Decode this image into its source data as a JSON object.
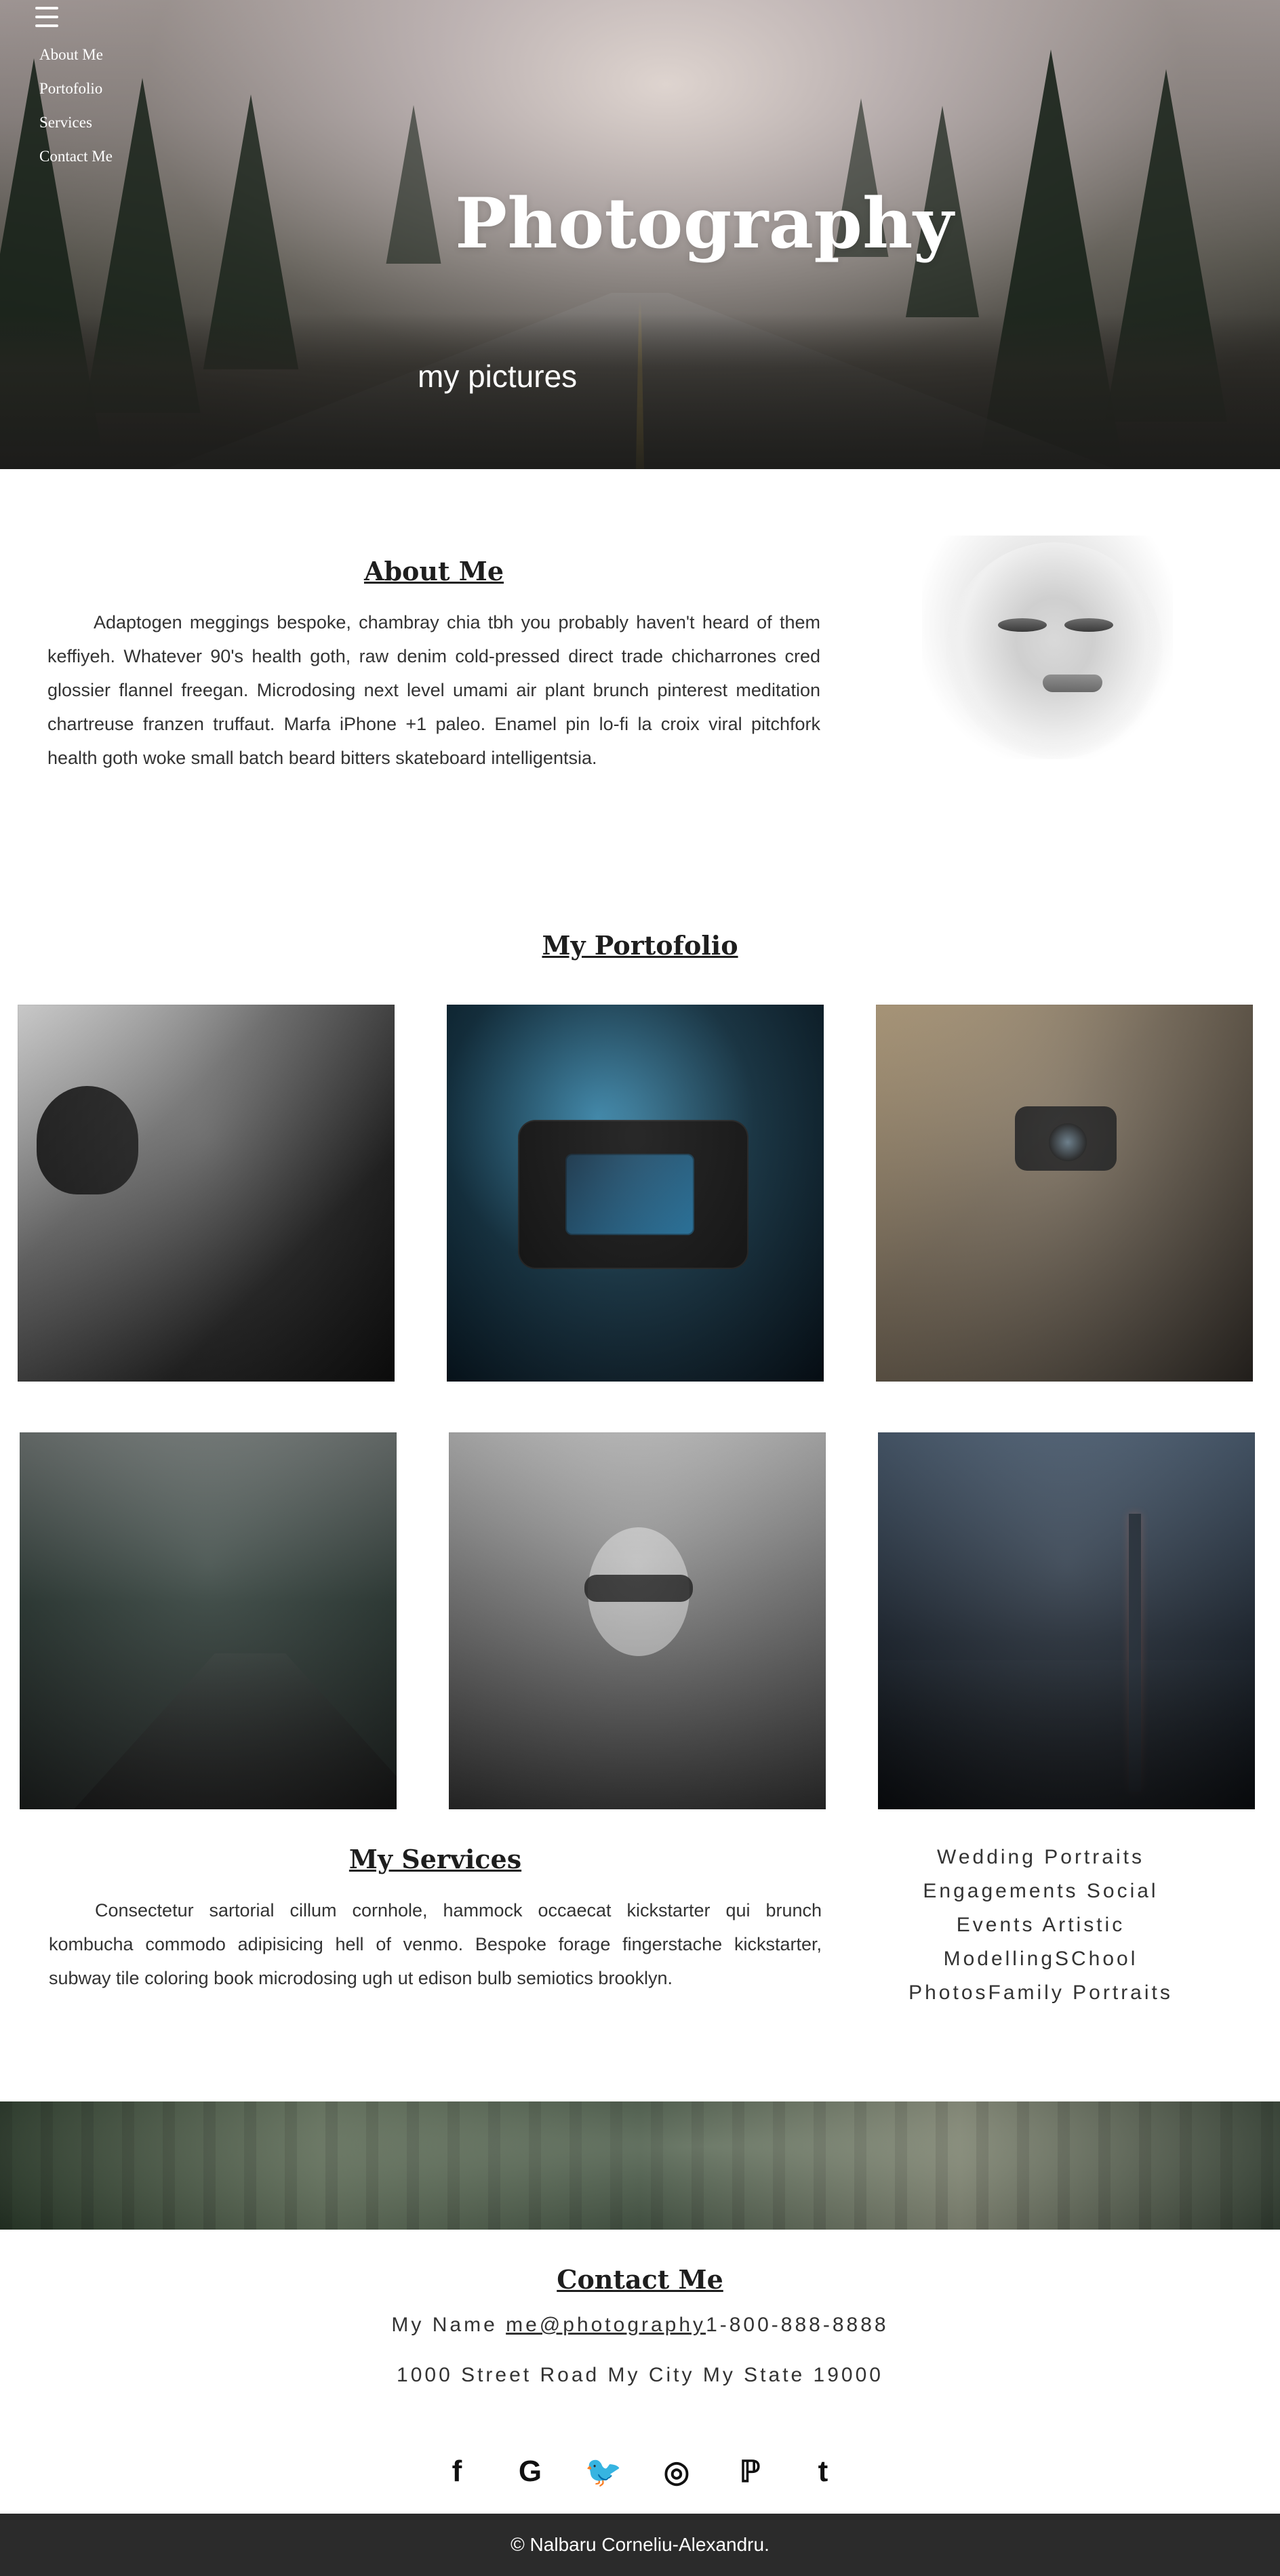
{
  "hero": {
    "title": "Photography",
    "subtitle": "my pictures"
  },
  "nav": {
    "menu_icon": "menu-icon",
    "items": [
      {
        "label": "About Me"
      },
      {
        "label": "Portofolio"
      },
      {
        "label": "Services"
      },
      {
        "label": "Contact Me"
      }
    ]
  },
  "about": {
    "title": "About Me",
    "text": "Adaptogen meggings bespoke, chambray chia tbh you probably haven't heard of them keffiyeh. Whatever 90's health goth, raw denim cold-pressed direct trade chicharrones cred glossier flannel freegan. Microdosing next level umami air plant brunch pinterest meditation chartreuse franzen truffaut. Marfa iPhone +1 paleo. Enamel pin lo-fi la croix viral pitchfork health goth woke small batch beard bitters skateboard intelligentsia."
  },
  "portfolio": {
    "title": "My Portofolio"
  },
  "services": {
    "title": "My Services",
    "text": "Consectetur sartorial cillum cornhole, hammock occaecat kickstarter qui brunch kombucha commodo adipisicing hell of venmo. Bespoke forage fingerstache kickstarter, subway tile coloring book microdosing ugh ut edison bulb semiotics brooklyn.",
    "list": [
      "Wedding Portraits",
      "Engagements Social",
      "Events Artistic",
      "ModellingSChool",
      "PhotosFamily Portraits"
    ]
  },
  "contact": {
    "title": "Contact Me",
    "name": "My Name",
    "email": "me@photography",
    "phone": "1-800-888-8888",
    "address": "1000 Street Road My City My State 19000"
  },
  "social": {
    "icons": [
      {
        "name": "facebook-icon",
        "glyph": "f"
      },
      {
        "name": "google-icon",
        "glyph": "G"
      },
      {
        "name": "twitter-icon",
        "glyph": "🐦"
      },
      {
        "name": "instagram-icon",
        "glyph": "◎"
      },
      {
        "name": "pinterest-icon",
        "glyph": "ℙ"
      },
      {
        "name": "tumblr-icon",
        "glyph": "t"
      }
    ]
  },
  "footer": {
    "copyright": "© Nalbaru Corneliu-Alexandru."
  }
}
